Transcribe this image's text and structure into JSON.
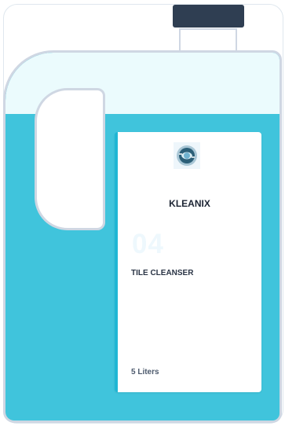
{
  "colors": {
    "liquid": "#40c4dc",
    "container_top": "#ebfbfd",
    "outline": "#cfd7e3",
    "cap": "#2f3e52",
    "label_accent": "#20b6d4"
  },
  "label": {
    "logo_icon": "kleanix-logo-icon",
    "brand": "KLEANIX",
    "number": "04",
    "product": "TILE CLEANSER",
    "volume": "5 Liters"
  }
}
